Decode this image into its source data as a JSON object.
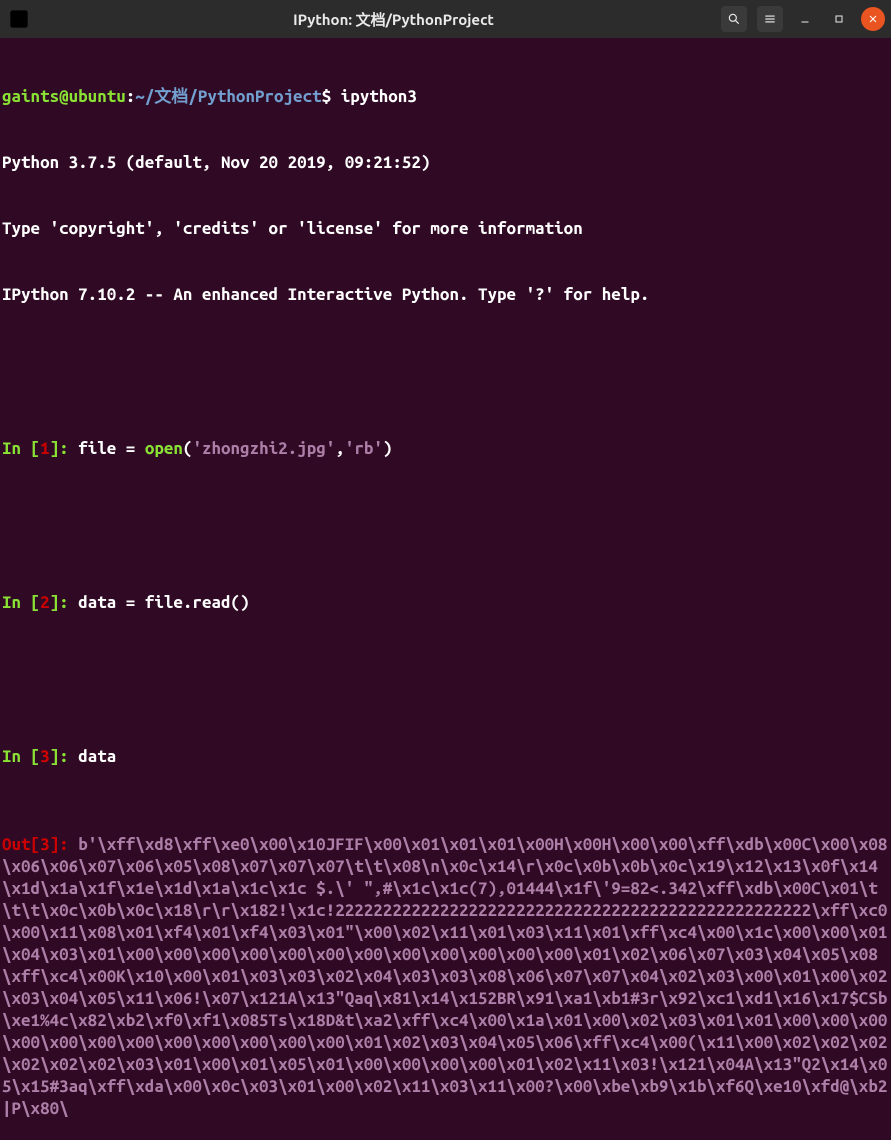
{
  "titlebar": {
    "title": "IPython: 文档/PythonProject"
  },
  "prompt": {
    "user_host": "gaints@ubuntu",
    "path": "~/文档/PythonProject",
    "dollar": "$",
    "command": "ipython3"
  },
  "banner": {
    "line1": "Python 3.7.5 (default, Nov 20 2019, 09:21:52)",
    "line2": "Type 'copyright', 'credits' or 'license' for more information",
    "line3": "IPython 7.10.2 -- An enhanced Interactive Python. Type '?' for help."
  },
  "cells": {
    "in1": {
      "prefix": "In [",
      "num": "1",
      "suffix": "]: ",
      "pre": "file = ",
      "func": "open",
      "open_paren": "(",
      "arg1": "'zhongzhi2.jpg'",
      "comma": ",",
      "arg2": "'rb'",
      "close_paren": ")"
    },
    "in2": {
      "prefix": "In [",
      "num": "2",
      "suffix": "]: ",
      "code": "data = file.read()"
    },
    "in3": {
      "prefix": "In [",
      "num": "3",
      "suffix": "]: ",
      "code": "data"
    },
    "out3": {
      "prefix": "Out[",
      "num": "3",
      "suffix": "]: ",
      "bytes": "b'\\xff\\xd8\\xff\\xe0\\x00\\x10JFIF\\x00\\x01\\x01\\x01\\x00H\\x00H\\x00\\x00\\xff\\xdb\\x00C\\x00\\x08\\x06\\x06\\x07\\x06\\x05\\x08\\x07\\x07\\x07\\t\\t\\x08\\n\\x0c\\x14\\r\\x0c\\x0b\\x0b\\x0c\\x19\\x12\\x13\\x0f\\x14\\x1d\\x1a\\x1f\\x1e\\x1d\\x1a\\x1c\\x1c $.\\' \",#\\x1c\\x1c(7),01444\\x1f\\'9=82<.342\\xff\\xdb\\x00C\\x01\\t\\t\\t\\x0c\\x0b\\x0c\\x18\\r\\r\\x182!\\x1c!22222222222222222222222222222222222222222222222222\\xff\\xc0\\x00\\x11\\x08\\x01\\xf4\\x01\\xf4\\x03\\x01\"\\x00\\x02\\x11\\x01\\x03\\x11\\x01\\xff\\xc4\\x00\\x1c\\x00\\x00\\x01\\x04\\x03\\x01\\x00\\x00\\x00\\x00\\x00\\x00\\x00\\x00\\x00\\x00\\x00\\x00\\x01\\x02\\x06\\x07\\x03\\x04\\x05\\x08\\xff\\xc4\\x00K\\x10\\x00\\x01\\x03\\x03\\x02\\x04\\x03\\x03\\x08\\x06\\x07\\x07\\x04\\x02\\x03\\x00\\x01\\x00\\x02\\x03\\x04\\x05\\x11\\x06!\\x07\\x121A\\x13\"Qaq\\x81\\x14\\x152BR\\x91\\xa1\\xb1#3r\\x92\\xc1\\xd1\\x16\\x17$CSb\\xe1%4c\\x82\\xb2\\xf0\\xf1\\x085Ts\\x18D&t\\xa2\\xff\\xc4\\x00\\x1a\\x01\\x00\\x02\\x03\\x01\\x01\\x00\\x00\\x00\\x00\\x00\\x00\\x00\\x00\\x00\\x00\\x00\\x00\\x01\\x02\\x03\\x04\\x05\\x06\\xff\\xc4\\x00(\\x11\\x00\\x02\\x02\\x02\\x02\\x02\\x02\\x03\\x01\\x00\\x01\\x05\\x01\\x00\\x00\\x00\\x00\\x01\\x02\\x11\\x03!\\x121\\x04A\\x13\"Q2\\x14\\x05\\x15#3aq\\xff\\xda\\x00\\x0c\\x03\\x01\\x00\\x02\\x11\\x03\\x11\\x00?\\x00\\xbe\\xb9\\x1b\\xf6Q\\xe10\\xfd@\\xb2|P\\x80\\"
    }
  }
}
